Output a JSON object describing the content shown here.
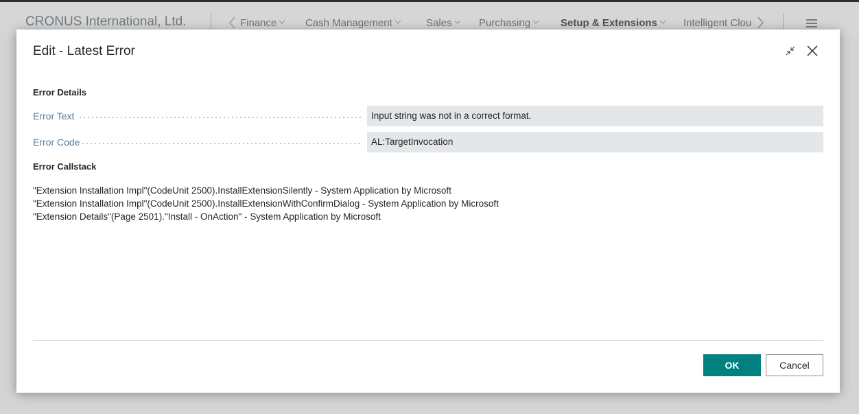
{
  "appbar": {
    "company": "CRONUS International, Ltd.",
    "nav_items": [
      {
        "label": "Finance"
      },
      {
        "label": "Cash Management"
      },
      {
        "label": "Sales"
      },
      {
        "label": "Purchasing"
      },
      {
        "label": "Setup & Extensions"
      },
      {
        "label": "Intelligent Clou"
      }
    ]
  },
  "dialog": {
    "title": "Edit - Latest Error",
    "group_details": "Error Details",
    "fields": [
      {
        "label": "Error Text",
        "value": "Input string was not in a correct format."
      },
      {
        "label": "Error Code",
        "value": "AL:TargetInvocation"
      }
    ],
    "group_callstack": "Error Callstack",
    "callstack": [
      "\"Extension Installation Impl\"(CodeUnit 2500).InstallExtensionSilently - System Application by Microsoft",
      "\"Extension Installation Impl\"(CodeUnit 2500).InstallExtensionWithConfirmDialog - System Application by Microsoft",
      "\"Extension Details\"(Page 2501).\"Install - OnAction\" - System Application by Microsoft"
    ],
    "ok_label": "OK",
    "cancel_label": "Cancel"
  },
  "colors": {
    "accent": "#00817f",
    "field_label": "#5a7d94",
    "field_bg": "#e4e7ea"
  }
}
